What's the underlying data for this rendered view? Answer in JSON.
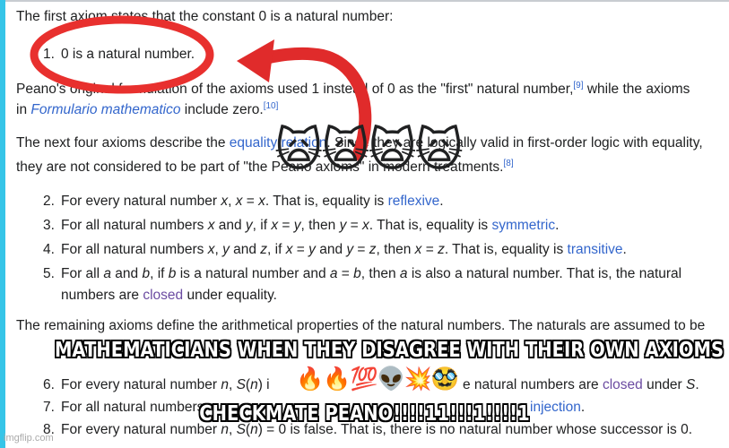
{
  "article": {
    "para1": "The first axiom states that the constant 0 is a natural number:",
    "item1": {
      "num": "1.",
      "text": "0 is a natural number."
    },
    "para2": {
      "a": "Peano's original formulation of the axioms used 1 instead of 0 as the \"first\" natural number,",
      "ref_a": "[9]",
      "b": " while the axioms",
      "c": "in ",
      "link": "Formulario mathematico",
      "d": " include zero.",
      "ref_b": "[10]"
    },
    "para3": {
      "a": "The next four axioms describe the ",
      "link": "equality relation",
      "b": ". Since they are logically valid in first-order logic with equality,",
      "c": "they are not considered to be part of \"the Peano axioms\" in modern treatments.",
      "ref": "[8]"
    },
    "item2": {
      "num": "2.",
      "a": "For every natural number ",
      "x": "x",
      "b": ", ",
      "c": "x",
      "d": " = ",
      "e": "x",
      "f": ". That is, equality is ",
      "link": "reflexive",
      "g": "."
    },
    "item3": {
      "num": "3.",
      "a": "For all natural numbers ",
      "x": "x",
      "b": " and ",
      "y": "y",
      "c": ", if ",
      "d": "x",
      "e": " = ",
      "f": "y",
      "g": ", then ",
      "h": "y",
      "i": " = ",
      "j": "x",
      "k": ". That is, equality is ",
      "link": "symmetric",
      "l": "."
    },
    "item4": {
      "num": "4.",
      "a": "For all natural numbers ",
      "x": "x",
      "b": ", ",
      "y": "y",
      "c": " and ",
      "z": "z",
      "d": ", if ",
      "e": "x",
      "f": " = ",
      "g": "y",
      "h": " and ",
      "i": "y",
      "j": " = ",
      "k": "z",
      "l": ", then ",
      "m": "x",
      "n": " = ",
      "o": "z",
      "p": ". That is, equality is ",
      "link": "transitive",
      "q": "."
    },
    "item5": {
      "num": "5.",
      "a": "For all ",
      "b": "a",
      "c": " and ",
      "d": "b",
      "e": ", if ",
      "f": "b",
      "g": " is a natural number and ",
      "h": "a",
      "i": " = ",
      "j": "b",
      "k": ", then ",
      "l": "a",
      "m": " is also a natural number. That is, the natural",
      "n": "numbers are ",
      "link": "closed",
      "o": " under equality."
    },
    "para4": "The remaining axioms define the arithmetical properties of the natural numbers. The naturals are assumed to be",
    "item6": {
      "num": "6.",
      "a": "For every natural number ",
      "n": "n",
      "b": ", ",
      "s": "S",
      "c": "(",
      "d": "n",
      "e": ") i",
      "f": "e natural numbers are ",
      "link": "closed",
      "g": " under ",
      "h": "S",
      "i": "."
    },
    "item7": {
      "num": "7.",
      "a": "For all natural numbers",
      "link": "injection",
      "b": "."
    },
    "item8": {
      "num": "8.",
      "a": "For every natural number ",
      "n": "n",
      "b": ", ",
      "s": "S",
      "c": "(",
      "d": "n",
      "e": ") = 0 is false. That is, there is no natural number whose successor is 0."
    }
  },
  "overlay": {
    "cats": "🙀🙀🙀🙀",
    "top_caption": "MATHEMATICIANS WHEN THEY DISAGREE WITH THEIR OWN AXIOMS",
    "emojis": "😹🔥🔥💯👽💥🥸",
    "bottom_caption": "CHECKMATE PEANO!!!!11!!!1!!!!1",
    "watermark": "imgflip.com"
  },
  "colors": {
    "link": "#3366cc",
    "visited_link": "#6b4ba1",
    "circle": "#e8302e",
    "arrow": "#e02b2b",
    "frame_accent": "#36c5e8"
  }
}
